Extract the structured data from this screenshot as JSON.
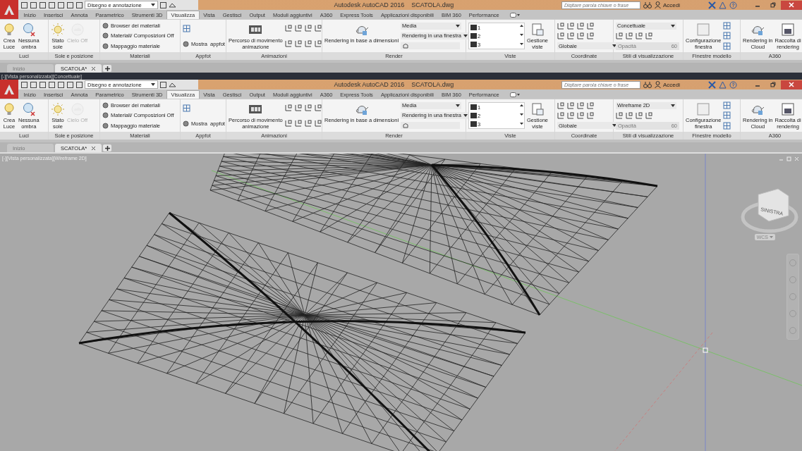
{
  "windows": [
    {
      "workspace": "Disegno e annotazione",
      "title": "Autodesk AutoCAD 2016",
      "file": "SCATOLA.dwg",
      "search": {
        "placeholder": "Digitare parola chiave o frase"
      },
      "account": "Accedi",
      "tabs": [
        {
          "label": "Inizio",
          "selected": false
        },
        {
          "label": "Inserisci",
          "selected": false
        },
        {
          "label": "Annota",
          "selected": false
        },
        {
          "label": "Parametrico",
          "selected": false
        },
        {
          "label": "Strumenti 3D",
          "selected": false
        },
        {
          "label": "Visualizza",
          "selected": true
        },
        {
          "label": "Vista",
          "selected": false
        },
        {
          "label": "Gestisci",
          "selected": false
        },
        {
          "label": "Output",
          "selected": false
        },
        {
          "label": "Moduli aggiuntivi",
          "selected": false
        },
        {
          "label": "A360",
          "selected": false
        },
        {
          "label": "Express Tools",
          "selected": false
        },
        {
          "label": "Applicazioni disponibili",
          "selected": false
        },
        {
          "label": "BIM 360",
          "selected": false
        },
        {
          "label": "Performance",
          "selected": false
        }
      ],
      "panels": [
        {
          "title": "Luci",
          "columns": [
            [
              {
                "kind": "large",
                "label": "Crea\nLuce",
                "disabled": false
              }
            ],
            [
              {
                "kind": "large",
                "label": "Nessuna\nombra",
                "disabled": false
              }
            ]
          ]
        },
        {
          "title": "Sole e posizione",
          "columns": [
            [
              {
                "kind": "large",
                "label": "Stato\nsole",
                "disabled": false
              }
            ],
            [
              {
                "kind": "large",
                "label": "Cielo Off",
                "disabled": true
              }
            ]
          ]
        },
        {
          "title": "Materiali",
          "columns": [
            [
              {
                "kind": "small",
                "label": "Browser dei materiali",
                "disabled": false
              },
              {
                "kind": "small",
                "label": "Materiali/ Composizioni Off",
                "disabled": false
              },
              {
                "kind": "small",
                "label": "Mappaggio materiale",
                "disabled": false
              }
            ]
          ]
        },
        {
          "title": "Appfot",
          "columns": [
            [
              {
                "kind": "icon"
              },
              {
                "kind": "small",
                "label": "Mostra  appfot",
                "disabled": false
              }
            ]
          ]
        },
        {
          "title": "Animazioni",
          "columns": [
            [
              {
                "kind": "large",
                "label": "Percorso di movimento\nanimazione",
                "disabled": false
              }
            ],
            [
              {
                "kind": "icon-row"
              },
              {
                "kind": "icon-row"
              }
            ]
          ]
        },
        {
          "title": "Render",
          "columns": [
            [
              {
                "kind": "large",
                "label": "Rendering in base a dimensioni",
                "disabled": false
              }
            ],
            [
              {
                "kind": "select",
                "label": "Media",
                "disabled": false
              },
              {
                "kind": "select",
                "label": "Rendering in una finestra",
                "disabled": false
              },
              {
                "kind": "icon-field"
              }
            ]
          ]
        },
        {
          "title": "Viste",
          "columns": [
            [
              {
                "kind": "list",
                "entries": [
                  "1",
                  "2",
                  "3"
                ],
                "disabled": false
              }
            ],
            [
              {
                "kind": "large",
                "label": "Gestione\nviste",
                "disabled": false
              }
            ]
          ]
        },
        {
          "title": "Coordinate",
          "columns": [
            [
              {
                "kind": "icon-row"
              },
              {
                "kind": "icon-row"
              },
              {
                "kind": "select",
                "label": "Globale",
                "disabled": false
              }
            ]
          ]
        },
        {
          "title": "Stili di visualizzazione",
          "columns": [
            [
              {
                "kind": "select",
                "label": "Concettuale",
                "disabled": false
              },
              {
                "kind": "icon-row"
              },
              {
                "kind": "slider",
                "label": "Opacità",
                "value": "60",
                "disabled": true
              }
            ]
          ]
        },
        {
          "title": "Finestre modello",
          "columns": [
            [
              {
                "kind": "large",
                "label": "Configurazione\nfinestra",
                "disabled": false
              }
            ],
            [
              {
                "kind": "icon"
              },
              {
                "kind": "icon"
              },
              {
                "kind": "icon"
              }
            ]
          ]
        },
        {
          "title": "A360",
          "columns": [
            [
              {
                "kind": "large",
                "label": "Rendering in\nCloud",
                "disabled": false
              }
            ],
            [
              {
                "kind": "large",
                "label": "Raccolta di\nrendering",
                "disabled": false
              }
            ]
          ]
        }
      ],
      "doc_tabs": [
        {
          "label": "Inizio",
          "selected": false
        },
        {
          "label": "SCATOLA*",
          "selected": true
        }
      ],
      "viewport": {
        "kind": "strip",
        "label": "[-][Vista personalizzata][Concettuale]"
      }
    },
    {
      "workspace": "Disegno e annotazione",
      "title": "Autodesk AutoCAD 2016",
      "file": "SCATOLA.dwg",
      "search": {
        "placeholder": "Digitare parola chiave o frase"
      },
      "account": "Accedi",
      "tabs": [
        {
          "label": "Inizio",
          "selected": false
        },
        {
          "label": "Inserisci",
          "selected": false
        },
        {
          "label": "Annota",
          "selected": false
        },
        {
          "label": "Parametrico",
          "selected": false
        },
        {
          "label": "Strumenti 3D",
          "selected": false
        },
        {
          "label": "Visualizza",
          "selected": true
        },
        {
          "label": "Vista",
          "selected": false
        },
        {
          "label": "Gestisci",
          "selected": false
        },
        {
          "label": "Output",
          "selected": false
        },
        {
          "label": "Moduli aggiuntivi",
          "selected": false
        },
        {
          "label": "A360",
          "selected": false
        },
        {
          "label": "Express Tools",
          "selected": false
        },
        {
          "label": "Applicazioni disponibili",
          "selected": false
        },
        {
          "label": "BIM 360",
          "selected": false
        },
        {
          "label": "Performance",
          "selected": false
        }
      ],
      "panels": [
        {
          "title": "Luci",
          "columns": [
            [
              {
                "kind": "large",
                "label": "Crea\nLuce",
                "disabled": false
              }
            ],
            [
              {
                "kind": "large",
                "label": "Nessuna\nombra",
                "disabled": false
              }
            ]
          ]
        },
        {
          "title": "Sole e posizione",
          "columns": [
            [
              {
                "kind": "large",
                "label": "Stato\nsole",
                "disabled": false
              }
            ],
            [
              {
                "kind": "large",
                "label": "Cielo Off",
                "disabled": true
              }
            ]
          ]
        },
        {
          "title": "Materiali",
          "columns": [
            [
              {
                "kind": "small",
                "label": "Browser dei materiali",
                "disabled": false
              },
              {
                "kind": "small",
                "label": "Materiali/ Composizioni Off",
                "disabled": false
              },
              {
                "kind": "small",
                "label": "Mappaggio materiale",
                "disabled": false
              }
            ]
          ]
        },
        {
          "title": "Appfot",
          "columns": [
            [
              {
                "kind": "icon"
              },
              {
                "kind": "small",
                "label": "Mostra  appfot",
                "disabled": false
              }
            ]
          ]
        },
        {
          "title": "Animazioni",
          "columns": [
            [
              {
                "kind": "large",
                "label": "Percorso di movimento\nanimazione",
                "disabled": false
              }
            ],
            [
              {
                "kind": "icon-row"
              },
              {
                "kind": "icon-row"
              }
            ]
          ]
        },
        {
          "title": "Render",
          "columns": [
            [
              {
                "kind": "large",
                "label": "Rendering in base a dimensioni",
                "disabled": false
              }
            ],
            [
              {
                "kind": "select",
                "label": "Media",
                "disabled": false
              },
              {
                "kind": "select",
                "label": "Rendering in una finestra",
                "disabled": false
              },
              {
                "kind": "icon-field"
              }
            ]
          ]
        },
        {
          "title": "Viste",
          "columns": [
            [
              {
                "kind": "list",
                "entries": [
                  "1",
                  "2",
                  "3"
                ],
                "disabled": false
              }
            ],
            [
              {
                "kind": "large",
                "label": "Gestione\nviste",
                "disabled": false
              }
            ]
          ]
        },
        {
          "title": "Coordinate",
          "columns": [
            [
              {
                "kind": "icon-row"
              },
              {
                "kind": "icon-row"
              },
              {
                "kind": "select",
                "label": "Globale",
                "disabled": false
              }
            ]
          ]
        },
        {
          "title": "Stili di visualizzazione",
          "columns": [
            [
              {
                "kind": "select",
                "label": "Wireframe 2D",
                "disabled": false
              },
              {
                "kind": "icon-row"
              },
              {
                "kind": "slider",
                "label": "Opacità",
                "value": "60",
                "disabled": true
              }
            ]
          ]
        },
        {
          "title": "Finestre modello",
          "columns": [
            [
              {
                "kind": "large",
                "label": "Configurazione\nfinestra",
                "disabled": false
              }
            ],
            [
              {
                "kind": "icon"
              },
              {
                "kind": "icon"
              },
              {
                "kind": "icon"
              }
            ]
          ]
        },
        {
          "title": "A360",
          "columns": [
            [
              {
                "kind": "large",
                "label": "Rendering in\nCloud",
                "disabled": false
              }
            ],
            [
              {
                "kind": "large",
                "label": "Raccolta di\nrendering",
                "disabled": false
              }
            ]
          ]
        }
      ],
      "doc_tabs": [
        {
          "label": "Inizio",
          "selected": false
        },
        {
          "label": "SCATOLA*",
          "selected": true
        }
      ],
      "viewport": {
        "kind": "model",
        "label": "[-][Vista personalizzata][Wireframe 2D]",
        "viewcube": {
          "face": "SINISTRA",
          "ucs": "WCS"
        }
      }
    }
  ]
}
